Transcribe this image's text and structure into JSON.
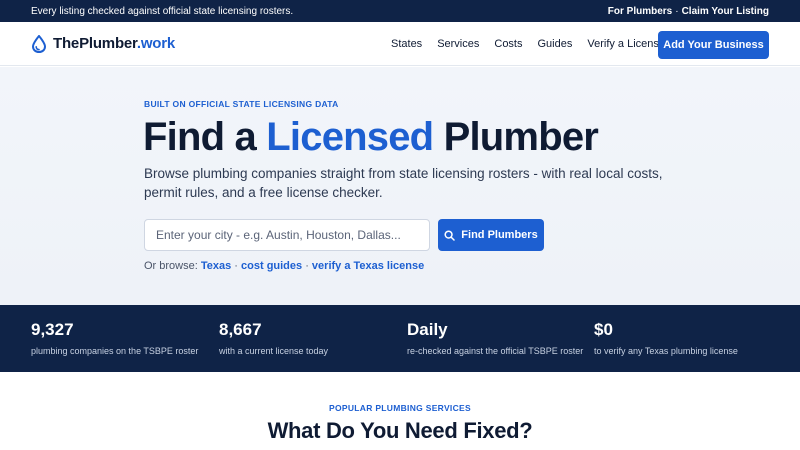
{
  "topbar": {
    "notice": "Every listing checked against official state licensing rosters.",
    "for_plumbers": "For Plumbers",
    "separator": "·",
    "claim": "Claim Your Listing"
  },
  "nav": {
    "logo_main": "ThePlumber",
    "logo_accent": ".work",
    "links": [
      "States",
      "Services",
      "Costs",
      "Guides",
      "Verify a License"
    ],
    "cta": "Add Your Business"
  },
  "hero": {
    "eyebrow": "BUILT ON OFFICIAL STATE LICENSING DATA",
    "headline_pre": "Find a ",
    "headline_highlight": "Licensed",
    "headline_post": " Plumber",
    "subtext": "Browse plumbing companies straight from state licensing rosters - with real local costs, permit rules, and a free license checker.",
    "search_placeholder": "Enter your city - e.g. Austin, Houston, Dallas...",
    "search_value": "",
    "search_button": "Find Plumbers",
    "browse_prefix": "Or browse: ",
    "browse_links": [
      "Texas",
      "cost guides",
      "verify a Texas license"
    ],
    "browse_sep": " · "
  },
  "stats": [
    {
      "value": "9,327",
      "label": "plumbing companies on the TSBPE roster"
    },
    {
      "value": "8,667",
      "label": "with a current license today"
    },
    {
      "value": "Daily",
      "label": "re-checked against the official TSBPE roster"
    },
    {
      "value": "$0",
      "label": "to verify any Texas plumbing license"
    }
  ],
  "section": {
    "eyebrow": "POPULAR PLUMBING SERVICES",
    "title": "What Do You Need Fixed?"
  },
  "colors": {
    "navy": "#0f2347",
    "accent": "#1d5fd1",
    "text": "#0f1b33"
  },
  "icons": {
    "logo": "water-drop-icon",
    "search": "search-icon"
  }
}
